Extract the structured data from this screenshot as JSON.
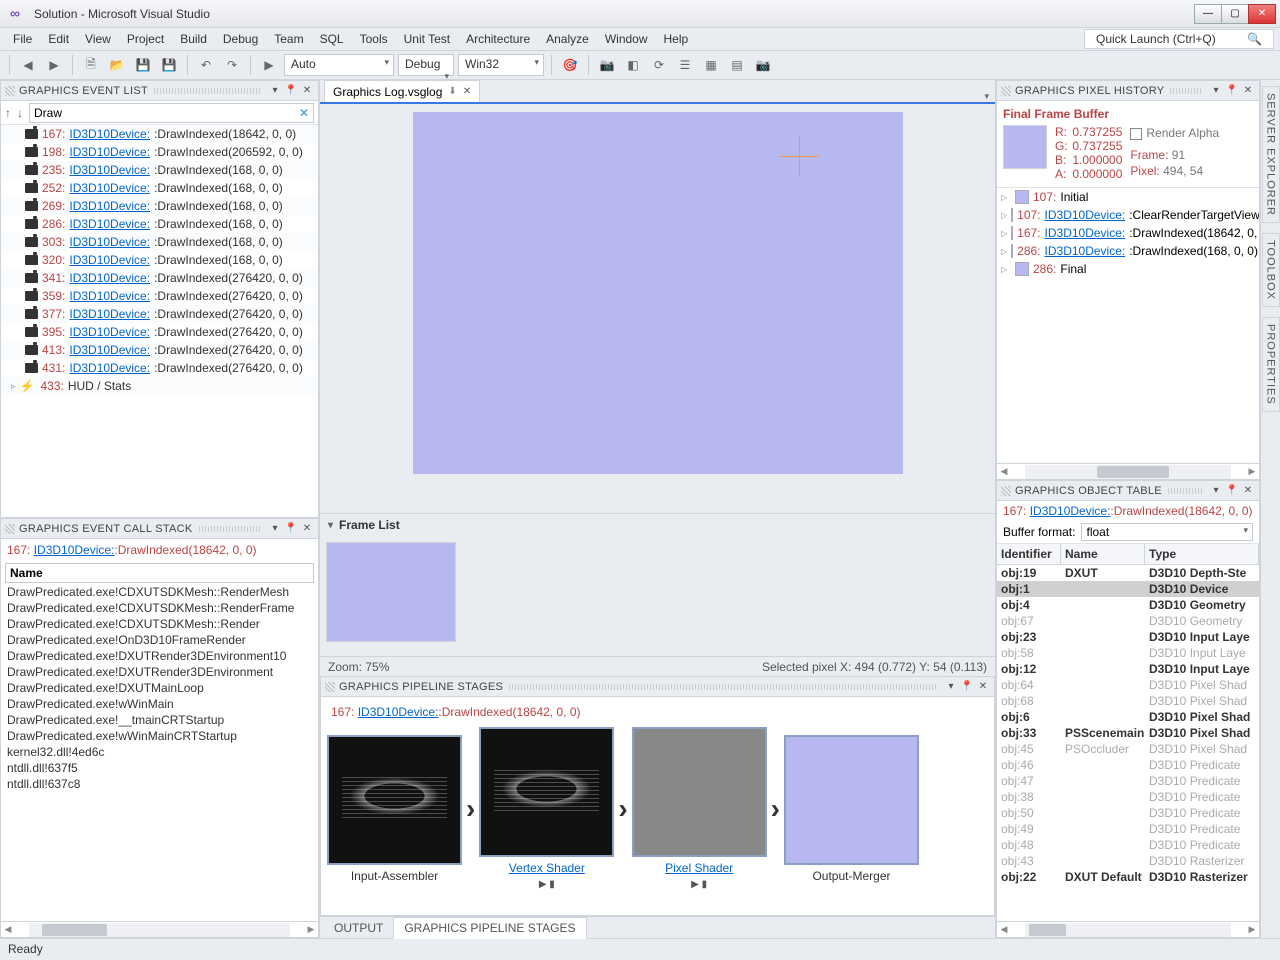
{
  "window": {
    "title": "Solution - Microsoft Visual Studio"
  },
  "menu": [
    "File",
    "Edit",
    "View",
    "Project",
    "Build",
    "Debug",
    "Team",
    "SQL",
    "Tools",
    "Unit Test",
    "Architecture",
    "Analyze",
    "Window",
    "Help"
  ],
  "quicklaunch_placeholder": "Quick Launch (Ctrl+Q)",
  "toolbar": {
    "config": "Auto",
    "solution_config": "Debug",
    "platform": "Win32"
  },
  "event_list": {
    "title": "GRAPHICS EVENT LIST",
    "filter": "Draw",
    "link": "ID3D10Device:",
    "items": [
      {
        "id": "167",
        "call": ":DrawIndexed(18642, 0, 0)"
      },
      {
        "id": "198",
        "call": ":DrawIndexed(206592, 0, 0)"
      },
      {
        "id": "235",
        "call": ":DrawIndexed(168, 0, 0)"
      },
      {
        "id": "252",
        "call": ":DrawIndexed(168, 0, 0)"
      },
      {
        "id": "269",
        "call": ":DrawIndexed(168, 0, 0)"
      },
      {
        "id": "286",
        "call": ":DrawIndexed(168, 0, 0)"
      },
      {
        "id": "303",
        "call": ":DrawIndexed(168, 0, 0)"
      },
      {
        "id": "320",
        "call": ":DrawIndexed(168, 0, 0)"
      },
      {
        "id": "341",
        "call": ":DrawIndexed(276420, 0, 0)"
      },
      {
        "id": "359",
        "call": ":DrawIndexed(276420, 0, 0)"
      },
      {
        "id": "377",
        "call": ":DrawIndexed(276420, 0, 0)"
      },
      {
        "id": "395",
        "call": ":DrawIndexed(276420, 0, 0)"
      },
      {
        "id": "413",
        "call": ":DrawIndexed(276420, 0, 0)"
      },
      {
        "id": "431",
        "call": ":DrawIndexed(276420, 0, 0)"
      }
    ],
    "last": {
      "id": "433",
      "label": "HUD / Stats"
    }
  },
  "call_stack": {
    "title": "GRAPHICS EVENT CALL STACK",
    "current": "167: ID3D10Device::DrawIndexed(18642, 0, 0)",
    "name_col": "Name",
    "frames": [
      "DrawPredicated.exe!CDXUTSDKMesh::RenderMesh",
      "DrawPredicated.exe!CDXUTSDKMesh::RenderFrame",
      "DrawPredicated.exe!CDXUTSDKMesh::Render",
      "DrawPredicated.exe!OnD3D10FrameRender",
      "DrawPredicated.exe!DXUTRender3DEnvironment10",
      "DrawPredicated.exe!DXUTRender3DEnvironment",
      "DrawPredicated.exe!DXUTMainLoop",
      "DrawPredicated.exe!wWinMain",
      "DrawPredicated.exe!__tmainCRTStartup",
      "DrawPredicated.exe!wWinMainCRTStartup",
      "kernel32.dll!4ed6c",
      "ntdll.dll!637f5",
      "ntdll.dll!637c8"
    ]
  },
  "doc": {
    "tab": "Graphics Log.vsglog",
    "frame_list": "Frame List",
    "zoom": "Zoom: 75%",
    "pixel": "Selected pixel X: 494 (0.772) Y: 54 (0.113)"
  },
  "pipeline": {
    "title": "GRAPHICS PIPELINE STAGES",
    "current": "167: ID3D10Device::DrawIndexed(18642, 0, 0)",
    "stages": [
      "Input-Assembler",
      "Vertex Shader",
      "Pixel Shader",
      "Output-Merger"
    ]
  },
  "bottom_tabs": [
    "OUTPUT",
    "GRAPHICS PIPELINE STAGES"
  ],
  "pixel_history": {
    "title": "GRAPHICS PIXEL HISTORY",
    "buffer": "Final Frame Buffer",
    "r": "0.737255",
    "g": "0.737255",
    "b": "1.000000",
    "a": "0.000000",
    "render_alpha": "Render Alpha",
    "frame_lbl": "Frame:",
    "frame_val": "91",
    "pixel_lbl": "Pixel:",
    "pixel_val": "494, 54",
    "events": [
      {
        "id": "107",
        "label": "Initial",
        "link": false
      },
      {
        "id": "107",
        "label": "ID3D10Device:",
        "rest": ":ClearRenderTargetView",
        "link": true
      },
      {
        "id": "167",
        "label": "ID3D10Device:",
        "rest": ":DrawIndexed(18642, 0,",
        "link": true
      },
      {
        "id": "286",
        "label": "ID3D10Device:",
        "rest": ":DrawIndexed(168, 0, 0)",
        "link": true
      },
      {
        "id": "286",
        "label": "Final",
        "link": false
      }
    ]
  },
  "object_table": {
    "title": "GRAPHICS OBJECT TABLE",
    "current": "167: ID3D10Device::DrawIndexed(18642, 0, 0)",
    "format_lbl": "Buffer format:",
    "format_val": "float",
    "cols": [
      "Identifier",
      "Name",
      "Type"
    ],
    "rows": [
      {
        "id": "obj:19",
        "name": "DXUT",
        "type": "D3D10 Depth-Ste",
        "dim": false
      },
      {
        "id": "obj:1",
        "name": "",
        "type": "D3D10 Device",
        "dim": false,
        "sel": true
      },
      {
        "id": "obj:4",
        "name": "",
        "type": "D3D10 Geometry",
        "dim": false
      },
      {
        "id": "obj:67",
        "name": "",
        "type": "D3D10 Geometry",
        "dim": true
      },
      {
        "id": "obj:23",
        "name": "",
        "type": "D3D10 Input Laye",
        "dim": false
      },
      {
        "id": "obj:58",
        "name": "",
        "type": "D3D10 Input Laye",
        "dim": true
      },
      {
        "id": "obj:12",
        "name": "",
        "type": "D3D10 Input Laye",
        "dim": false
      },
      {
        "id": "obj:64",
        "name": "",
        "type": "D3D10 Pixel Shad",
        "dim": true
      },
      {
        "id": "obj:68",
        "name": "",
        "type": "D3D10 Pixel Shad",
        "dim": true
      },
      {
        "id": "obj:6",
        "name": "",
        "type": "D3D10 Pixel Shad",
        "dim": false
      },
      {
        "id": "obj:33",
        "name": "PSScenemain",
        "type": "D3D10 Pixel Shad",
        "dim": false
      },
      {
        "id": "obj:45",
        "name": "PSOccluder",
        "type": "D3D10 Pixel Shad",
        "dim": true
      },
      {
        "id": "obj:46",
        "name": "",
        "type": "D3D10 Predicate",
        "dim": true
      },
      {
        "id": "obj:47",
        "name": "",
        "type": "D3D10 Predicate",
        "dim": true
      },
      {
        "id": "obj:38",
        "name": "",
        "type": "D3D10 Predicate",
        "dim": true
      },
      {
        "id": "obj:50",
        "name": "",
        "type": "D3D10 Predicate",
        "dim": true
      },
      {
        "id": "obj:49",
        "name": "",
        "type": "D3D10 Predicate",
        "dim": true
      },
      {
        "id": "obj:48",
        "name": "",
        "type": "D3D10 Predicate",
        "dim": true
      },
      {
        "id": "obj:43",
        "name": "",
        "type": "D3D10 Rasterizer",
        "dim": true
      },
      {
        "id": "obj:22",
        "name": "DXUT Default",
        "type": "D3D10 Rasterizer",
        "dim": false
      }
    ]
  },
  "rail": [
    "SERVER EXPLORER",
    "TOOLBOX",
    "PROPERTIES"
  ],
  "status": "Ready"
}
